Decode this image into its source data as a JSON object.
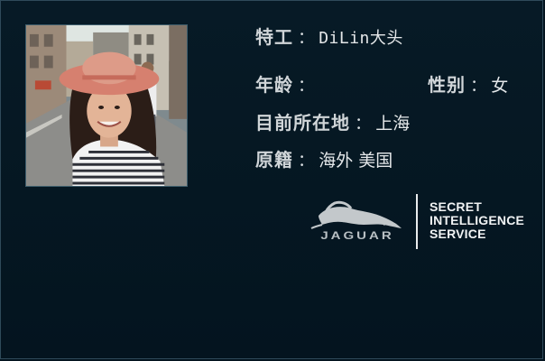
{
  "profile": {
    "codename_label": "特工",
    "codename_value": "DiLin大头",
    "age_label": "年龄",
    "age_value": "",
    "gender_label": "性别",
    "gender_value": "女",
    "location_label": "目前所在地",
    "location_value": "上海",
    "origin_label": "原籍",
    "origin_value": "海外  美国",
    "separator": "："
  },
  "branding": {
    "jaguar_wordmark": "JAGUAR",
    "sis_line1": "SECRET",
    "sis_line2": "INTELLIGENCE",
    "sis_line3": "SERVICE"
  },
  "colors": {
    "background": "#04141f",
    "border": "#2f4a5a",
    "text": "#d8dde0"
  },
  "icons": {
    "leaper": "jaguar-leaper-icon"
  }
}
